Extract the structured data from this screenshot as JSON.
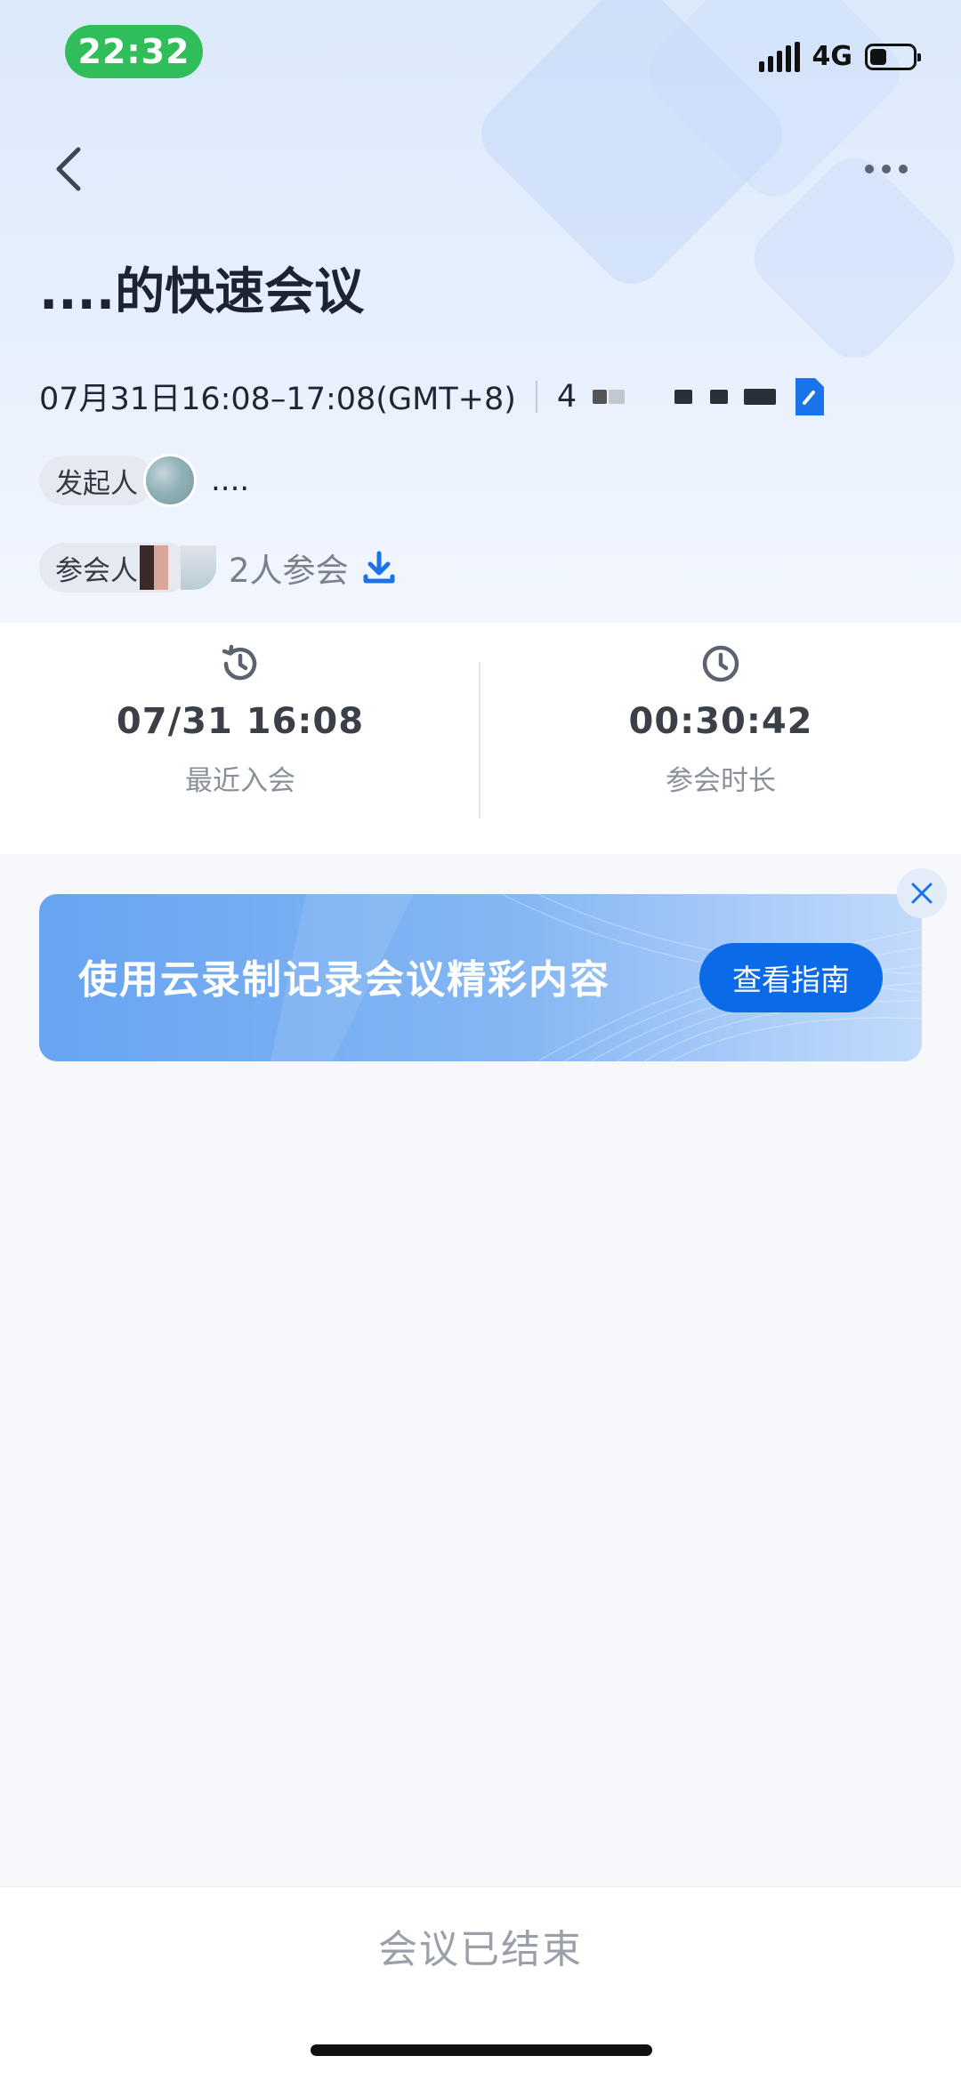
{
  "status_bar": {
    "time": "22:32",
    "network": "4G",
    "battery_level": 0.4
  },
  "meeting": {
    "title": "....的快速会议",
    "datetime": "07月31日16:08–17:08(GMT+8)",
    "meeting_id_prefix": "4",
    "host_label": "发起人",
    "host_name": "....",
    "participants_label": "参会人",
    "participants_count": "2人参会"
  },
  "stats": {
    "last_join": {
      "value": "07/31 16:08",
      "label": "最近入会"
    },
    "duration": {
      "value": "00:30:42",
      "label": "参会时长"
    }
  },
  "banner": {
    "text": "使用云录制记录会议精彩内容",
    "button_label": "查看指南"
  },
  "footer": {
    "status_text": "会议已结束"
  },
  "icons": {
    "back": "chevron-left-icon",
    "more": "more-horizontal-icon",
    "doc": "document-icon",
    "download": "download-icon",
    "history": "history-clock-icon",
    "clock": "clock-icon",
    "close": "close-icon"
  },
  "colors": {
    "accent": "#0a6ae8",
    "time_pill": "#2fbe5a"
  }
}
